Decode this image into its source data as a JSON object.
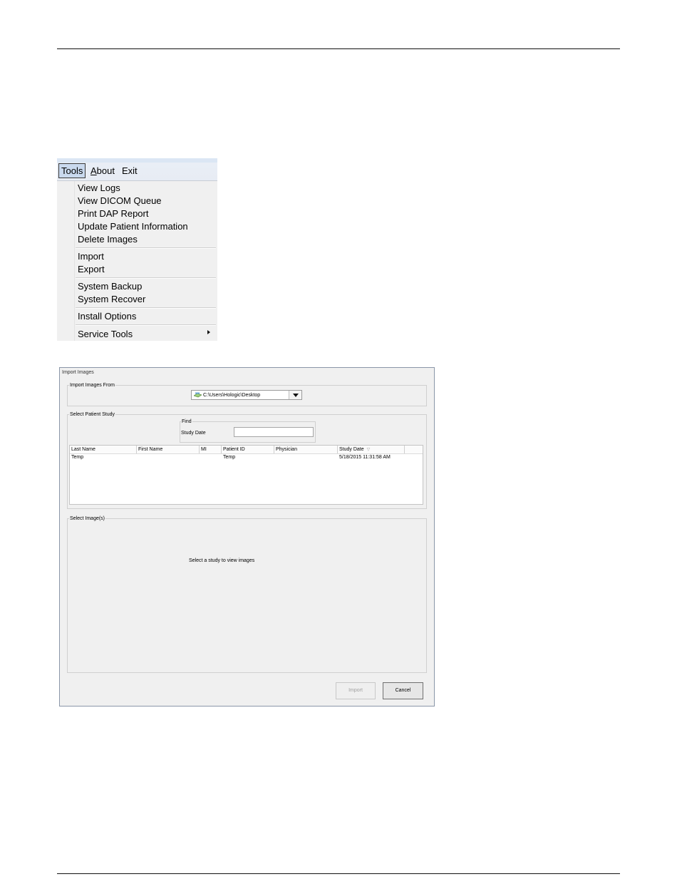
{
  "menu": {
    "menubar": {
      "tools": "Tools",
      "about_underline": "A",
      "about_rest": "bout",
      "exit": "Exit"
    },
    "items": {
      "view_logs": "View Logs",
      "view_dicom_queue": "View DICOM Queue",
      "print_dap_report": "Print DAP Report",
      "update_patient_information": "Update Patient Information",
      "delete_images": "Delete Images",
      "import": "Import",
      "export": "Export",
      "system_backup": "System Backup",
      "system_recover": "System Recover",
      "install_options": "Install Options",
      "service_tools": "Service Tools"
    },
    "icons": {
      "submenu": "submenu-arrow-icon"
    }
  },
  "dialog": {
    "title": "Import Images",
    "import_from": {
      "label": "Import Images From",
      "path": "C:\\Users\\Hologic\\Desktop",
      "icon": "drive-icon"
    },
    "patient_study": {
      "label": "Select Patient Study",
      "find_label": "Find",
      "study_date_label": "Study Date",
      "study_date_value": "",
      "columns": {
        "last_name": "Last Name",
        "first_name": "First Name",
        "mi": "MI",
        "patient_id": "Patient ID",
        "physician": "Physician",
        "study_date": "Study Date"
      },
      "rows": [
        {
          "last_name": "Temp",
          "first_name": "",
          "mi": "",
          "patient_id": "Temp",
          "physician": "",
          "study_date": "5/18/2015 11:31:58 AM"
        }
      ]
    },
    "images": {
      "label": "Select Image(s)",
      "empty_message": "Select a study to view images"
    },
    "buttons": {
      "import": "Import",
      "cancel": "Cancel"
    }
  }
}
